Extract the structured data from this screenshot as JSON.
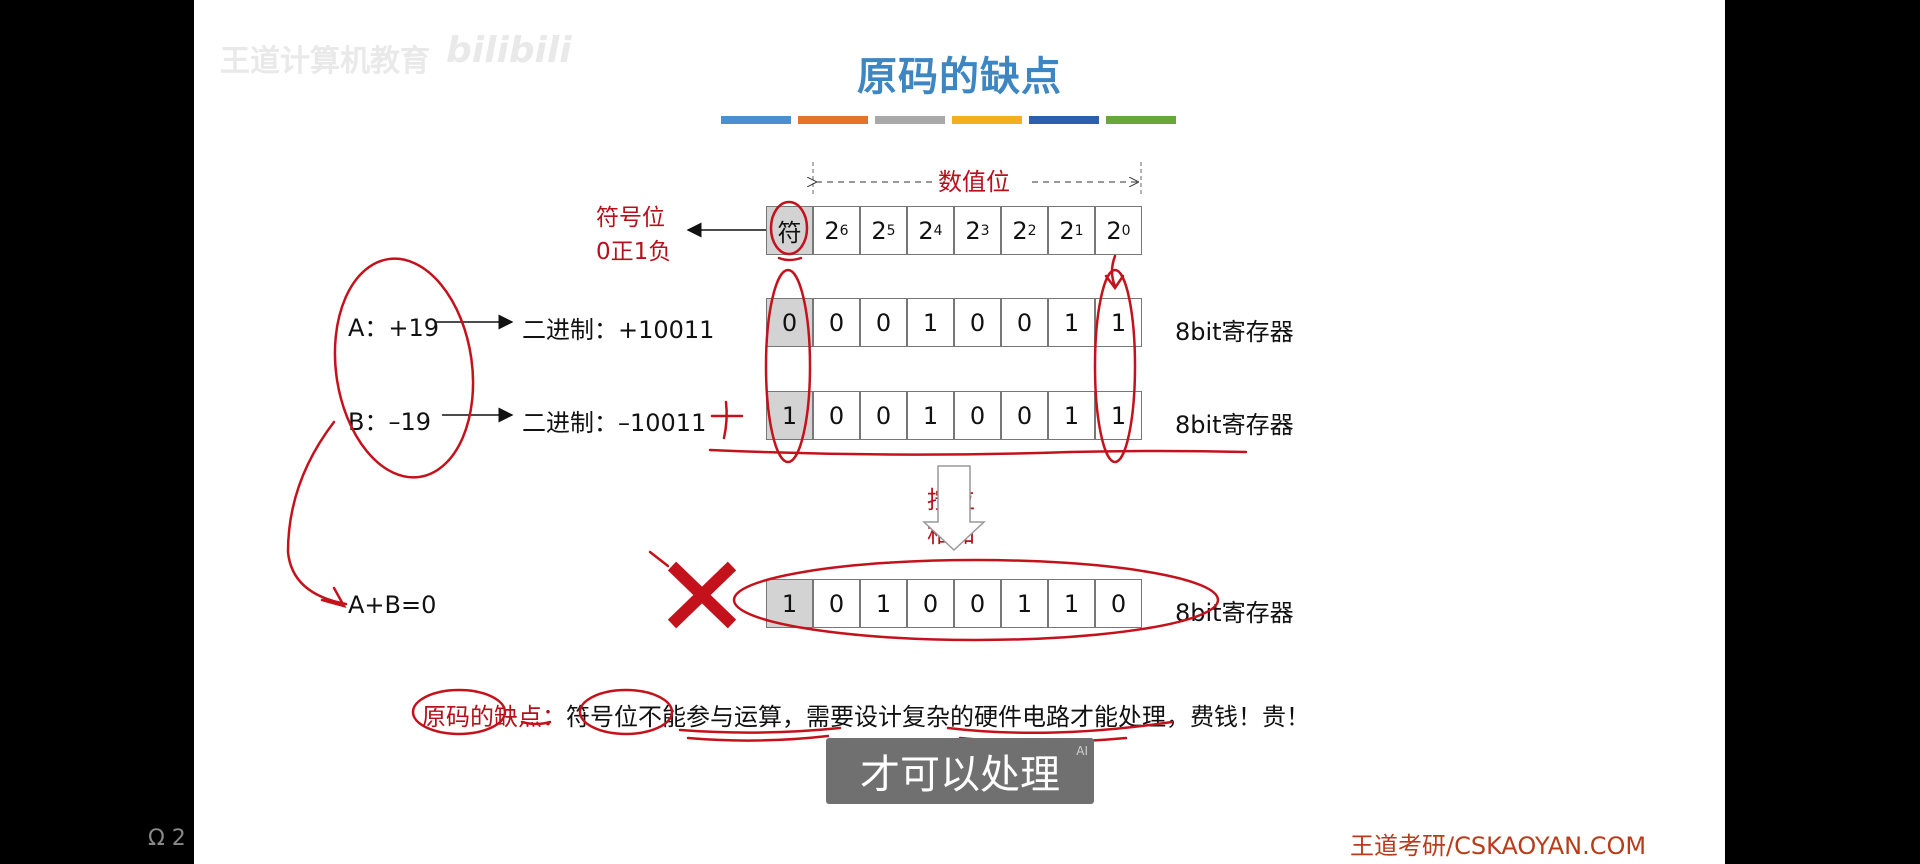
{
  "slide": {
    "title": "原码的缺点",
    "watermark_left": "王道计算机教育",
    "watermark_logo": "bilibili",
    "value_bits_label": "数值位",
    "sign_bit_label_1": "符号位",
    "sign_bit_label_2": "0正1负",
    "header_cells": [
      "符",
      "2",
      "2",
      "2",
      "2",
      "2",
      "2",
      "2"
    ],
    "header_exps": [
      "",
      "6",
      "5",
      "4",
      "3",
      "2",
      "1",
      "0"
    ],
    "row_a": {
      "label": "A：+19",
      "binary": "二进制：+10011",
      "bits": [
        "0",
        "0",
        "0",
        "1",
        "0",
        "0",
        "1",
        "1"
      ],
      "register": "8bit寄存器"
    },
    "row_b": {
      "label": "B：–19",
      "binary": "二进制：–10011",
      "bits": [
        "1",
        "0",
        "0",
        "1",
        "0",
        "0",
        "1",
        "1"
      ],
      "register": "8bit寄存器"
    },
    "add_label_1": "按位",
    "add_label_2": "相加",
    "result": {
      "label": "A+B=0",
      "bits": [
        "1",
        "0",
        "1",
        "0",
        "0",
        "1",
        "1",
        "0"
      ],
      "register": "8bit寄存器"
    },
    "conclusion_prefix": "原码的缺点：",
    "conclusion_body": "符号位不能参与运算，需要设计复杂的硬件电路才能处理，费钱！贵！",
    "footer": "王道考研/CSKAOYAN.COM"
  },
  "subtitle": {
    "text": "才可以处理",
    "tag": "AI"
  },
  "corner_text": "Ω 2",
  "colors": {
    "title": "#3e86c2",
    "annotation_red": "#c4121c",
    "bar_colors": [
      "#4a8fd0",
      "#e5742a",
      "#a9a9a9",
      "#f2b01e",
      "#2d5fae",
      "#68a83a"
    ]
  }
}
